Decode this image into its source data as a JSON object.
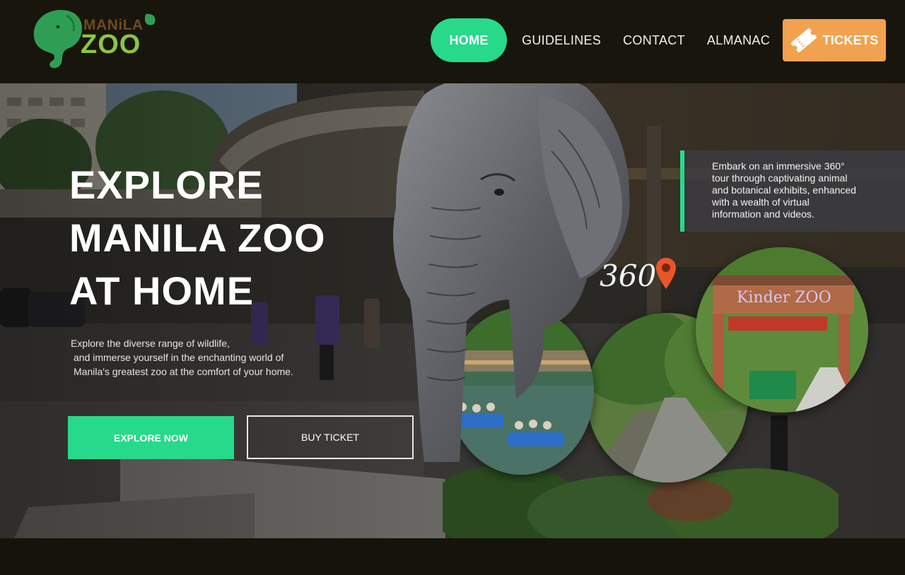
{
  "brand": {
    "name_top": "MANiLA",
    "name_bottom": "ZOO",
    "colors": {
      "elephant": "#2f9e55",
      "zoo_text": "#8cc63f",
      "manila_text": "#6b4a23"
    }
  },
  "nav": {
    "home": "HOME",
    "guidelines": "GUIDELINES",
    "contact": "CONTACT",
    "almanac": "ALMANAC",
    "tickets": "TICKETS",
    "active": "HOME",
    "tickets_icon": "ticket-icon"
  },
  "hero": {
    "title_lines": [
      "EXPLORE",
      "MANILA ZOO",
      "AT HOME"
    ],
    "description_lines": [
      "Explore the diverse range of wildlife,",
      "and immerse yourself in the enchanting world of",
      "Manila's greatest zoo at the comfort of your home."
    ],
    "explore_button": "EXPLORE NOW",
    "buy_button": "BUY TICKET"
  },
  "info_box": {
    "lines": [
      "Embark on an immersive 360°",
      "tour through captivating animal",
      "and botanical exhibits, enhanced",
      "with a wealth of virtual",
      "information and videos."
    ]
  },
  "tour": {
    "label": "360",
    "pin_icon": "location-pin-icon",
    "sign_text": "Kinder ZOO"
  },
  "colors": {
    "accent_green": "#27d98a",
    "tickets_orange": "#f2a24e",
    "header_bg": "#18150c",
    "pin": "#e8552b"
  }
}
